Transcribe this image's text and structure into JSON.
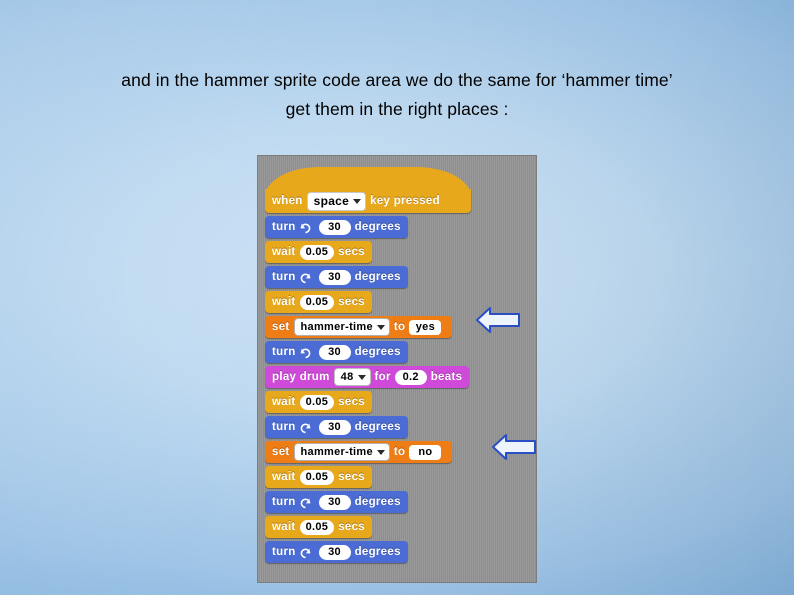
{
  "caption": {
    "line1": "and in the hammer sprite code area we do the same for ‘hammer time’",
    "line2": "get them in the right places :"
  },
  "script": {
    "hat": {
      "when": "when",
      "key": "space",
      "key_pressed": "key pressed"
    },
    "blocks": [
      {
        "kind": "turn-right",
        "label": "turn",
        "value": "30",
        "unit": "degrees",
        "color": "#4a6cd4"
      },
      {
        "kind": "wait",
        "label": "wait",
        "value": "0.05",
        "unit": "secs",
        "color": "#e8a81c"
      },
      {
        "kind": "turn-left",
        "label": "turn",
        "value": "30",
        "unit": "degrees",
        "color": "#4a6cd4"
      },
      {
        "kind": "wait",
        "label": "wait",
        "value": "0.05",
        "unit": "secs",
        "color": "#e8a81c"
      },
      {
        "kind": "set",
        "label": "set",
        "variable": "hammer-time",
        "to": "to",
        "value": "yes",
        "color": "#ee7d16",
        "arrow": true
      },
      {
        "kind": "turn-right",
        "label": "turn",
        "value": "30",
        "unit": "degrees",
        "color": "#4a6cd4"
      },
      {
        "kind": "play-drum",
        "label": "play drum",
        "drum": "48",
        "for": "for",
        "beats_value": "0.2",
        "beats": "beats",
        "color": "#cf4ad9"
      },
      {
        "kind": "wait",
        "label": "wait",
        "value": "0.05",
        "unit": "secs",
        "color": "#e8a81c"
      },
      {
        "kind": "turn-left",
        "label": "turn",
        "value": "30",
        "unit": "degrees",
        "color": "#4a6cd4"
      },
      {
        "kind": "set",
        "label": "set",
        "variable": "hammer-time",
        "to": "to",
        "value": "no",
        "color": "#ee7d16",
        "arrow": true
      },
      {
        "kind": "wait",
        "label": "wait",
        "value": "0.05",
        "unit": "secs",
        "color": "#e8a81c"
      },
      {
        "kind": "turn-left",
        "label": "turn",
        "value": "30",
        "unit": "degrees",
        "color": "#4a6cd4"
      },
      {
        "kind": "wait",
        "label": "wait",
        "value": "0.05",
        "unit": "secs",
        "color": "#e8a81c"
      },
      {
        "kind": "turn-left",
        "label": "turn",
        "value": "30",
        "unit": "degrees",
        "color": "#4a6cd4"
      }
    ]
  }
}
